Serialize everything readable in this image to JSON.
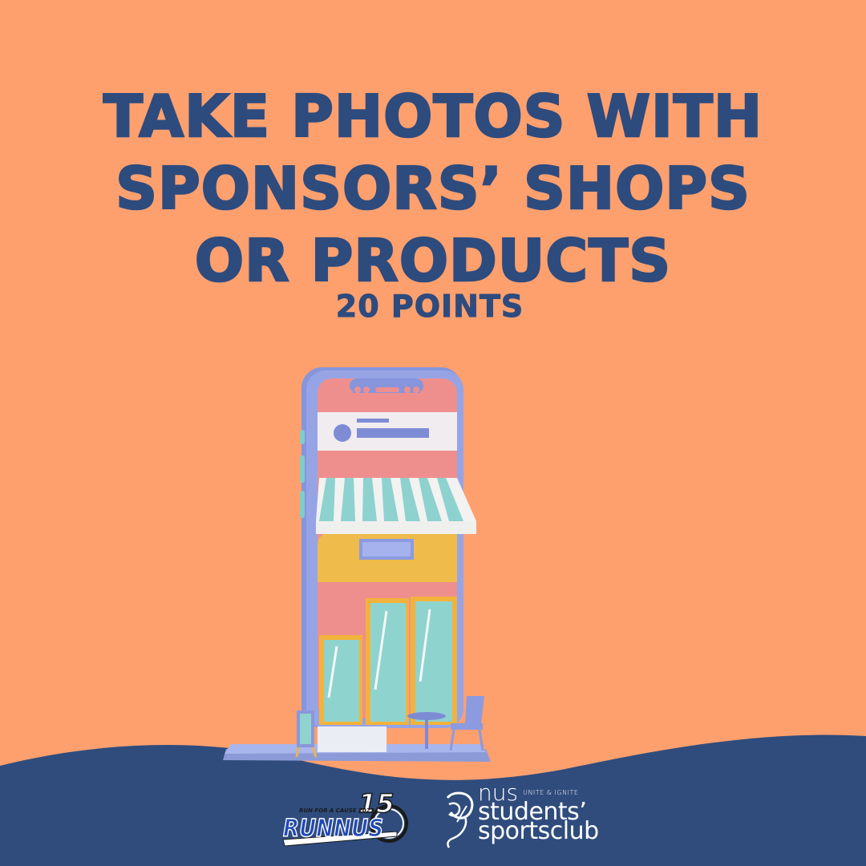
{
  "headline": {
    "line1": "TAKE PHOTOS WITH",
    "line2": "SPONSORS’ SHOPS",
    "line3": "OR PRODUCTS"
  },
  "points_label": "20 POINTS",
  "colors": {
    "background": "#FDA06E",
    "text": "#2E4B7E",
    "wave": "#2F4C7D"
  },
  "logos": {
    "runnus": {
      "tagline": "RUN FOR A CAUSE 2021",
      "wordmark": "RUNNUS",
      "number": "15"
    },
    "ssc": {
      "line1": "nus",
      "tag": "UNITE & IGNITE",
      "line2": "students’",
      "line3": "sportsclub"
    }
  }
}
